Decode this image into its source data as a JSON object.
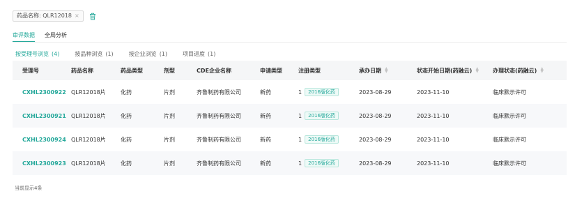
{
  "filter": {
    "tag_label": "药品名称: QLR12018",
    "close_glyph": "×",
    "trash_icon": "trash-icon"
  },
  "tabs": [
    {
      "label": "审评数据",
      "active": true
    },
    {
      "label": "全局分析",
      "active": false
    }
  ],
  "subtabs": [
    {
      "label": "按受理号浏览",
      "count": "(4)",
      "active": true
    },
    {
      "label": "按品种浏览",
      "count": "(1)",
      "active": false
    },
    {
      "label": "按企业浏览",
      "count": "(1)",
      "active": false
    },
    {
      "label": "项目进度",
      "count": "(1)",
      "active": false
    }
  ],
  "table": {
    "headers": [
      "受理号",
      "药品名称",
      "药品类型",
      "剂型",
      "CDE企业名称",
      "申请类型",
      "注册类型",
      "承办日期",
      "状态开始日期(药融云)",
      "办理状态(药融云)"
    ],
    "rows": [
      {
        "id": "CXHL2300922",
        "name": "QLR12018片",
        "drug_type": "化药",
        "form": "片剂",
        "company": "齐鲁制药有限公司",
        "apply_type": "新药",
        "reg_num": "1",
        "reg_tag": "2016版化药",
        "date": "2023-08-29",
        "status_date": "2023-11-10",
        "status": "临床默示许可"
      },
      {
        "id": "CXHL2300921",
        "name": "QLR12018片",
        "drug_type": "化药",
        "form": "片剂",
        "company": "齐鲁制药有限公司",
        "apply_type": "新药",
        "reg_num": "1",
        "reg_tag": "2016版化药",
        "date": "2023-08-29",
        "status_date": "2023-11-10",
        "status": "临床默示许可"
      },
      {
        "id": "CXHL2300924",
        "name": "QLR12018片",
        "drug_type": "化药",
        "form": "片剂",
        "company": "齐鲁制药有限公司",
        "apply_type": "新药",
        "reg_num": "1",
        "reg_tag": "2016版化药",
        "date": "2023-08-29",
        "status_date": "2023-11-10",
        "status": "临床默示许可"
      },
      {
        "id": "CXHL2300923",
        "name": "QLR12018片",
        "drug_type": "化药",
        "form": "片剂",
        "company": "齐鲁制药有限公司",
        "apply_type": "新药",
        "reg_num": "1",
        "reg_tag": "2016版化药",
        "date": "2023-08-29",
        "status_date": "2023-11-10",
        "status": "临床默示许可"
      }
    ]
  },
  "footer": {
    "text": "当前显示4条"
  },
  "colors": {
    "accent": "#24a89a"
  }
}
